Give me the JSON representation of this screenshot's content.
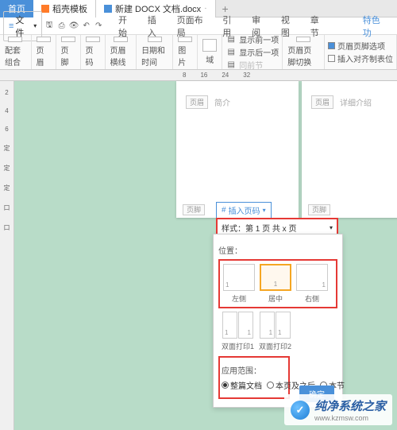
{
  "tabs": {
    "home": "首页",
    "tpl": "稻壳模板",
    "doc": "新建 DOCX 文档.docx"
  },
  "file_menu": "文件",
  "menu": [
    "开始",
    "插入",
    "页面布局",
    "引用",
    "审阅",
    "视图",
    "章节",
    "",
    "特色功"
  ],
  "ribbon": {
    "g1": "配套组合",
    "g2": "页眉",
    "g3": "页脚",
    "g4": "页码",
    "g5": "页眉横线",
    "g6": "日期和时间",
    "g7": "图片",
    "g8": "域",
    "r1": "显示前一项",
    "r2": "显示后一项",
    "r3": "同前节",
    "c1": "页眉页脚切换",
    "c2": "页眉页脚选项",
    "c3": "插入对齐制表位"
  },
  "ruler": [
    "8",
    "16",
    "24",
    "32"
  ],
  "vruler": [
    "2",
    "4",
    "6",
    "定",
    "定",
    "定",
    "口",
    "口"
  ],
  "page1": {
    "hdr_tag": "页眉",
    "title": "简介",
    "ft": "页脚"
  },
  "page2": {
    "hdr_tag": "页眉",
    "title": "详细介绍",
    "ft": "页脚"
  },
  "insert_btn": "插入页码",
  "popup": {
    "style_label": "样式：",
    "style_value": "第 1 页 共 x 页",
    "pos_label": "位置：",
    "thumbs": {
      "left": "左侧",
      "center": "居中",
      "right": "右侧",
      "d1": "双面打印1",
      "d2": "双面打印2",
      "pgnum": "1"
    },
    "scope_label": "应用范围：",
    "scope": {
      "whole": "整篇文档",
      "after": "本页及之后",
      "section": "本节"
    },
    "ok": "确定"
  },
  "watermark": {
    "brand": "纯净系统之家",
    "url": "www.kzmsw.com"
  }
}
